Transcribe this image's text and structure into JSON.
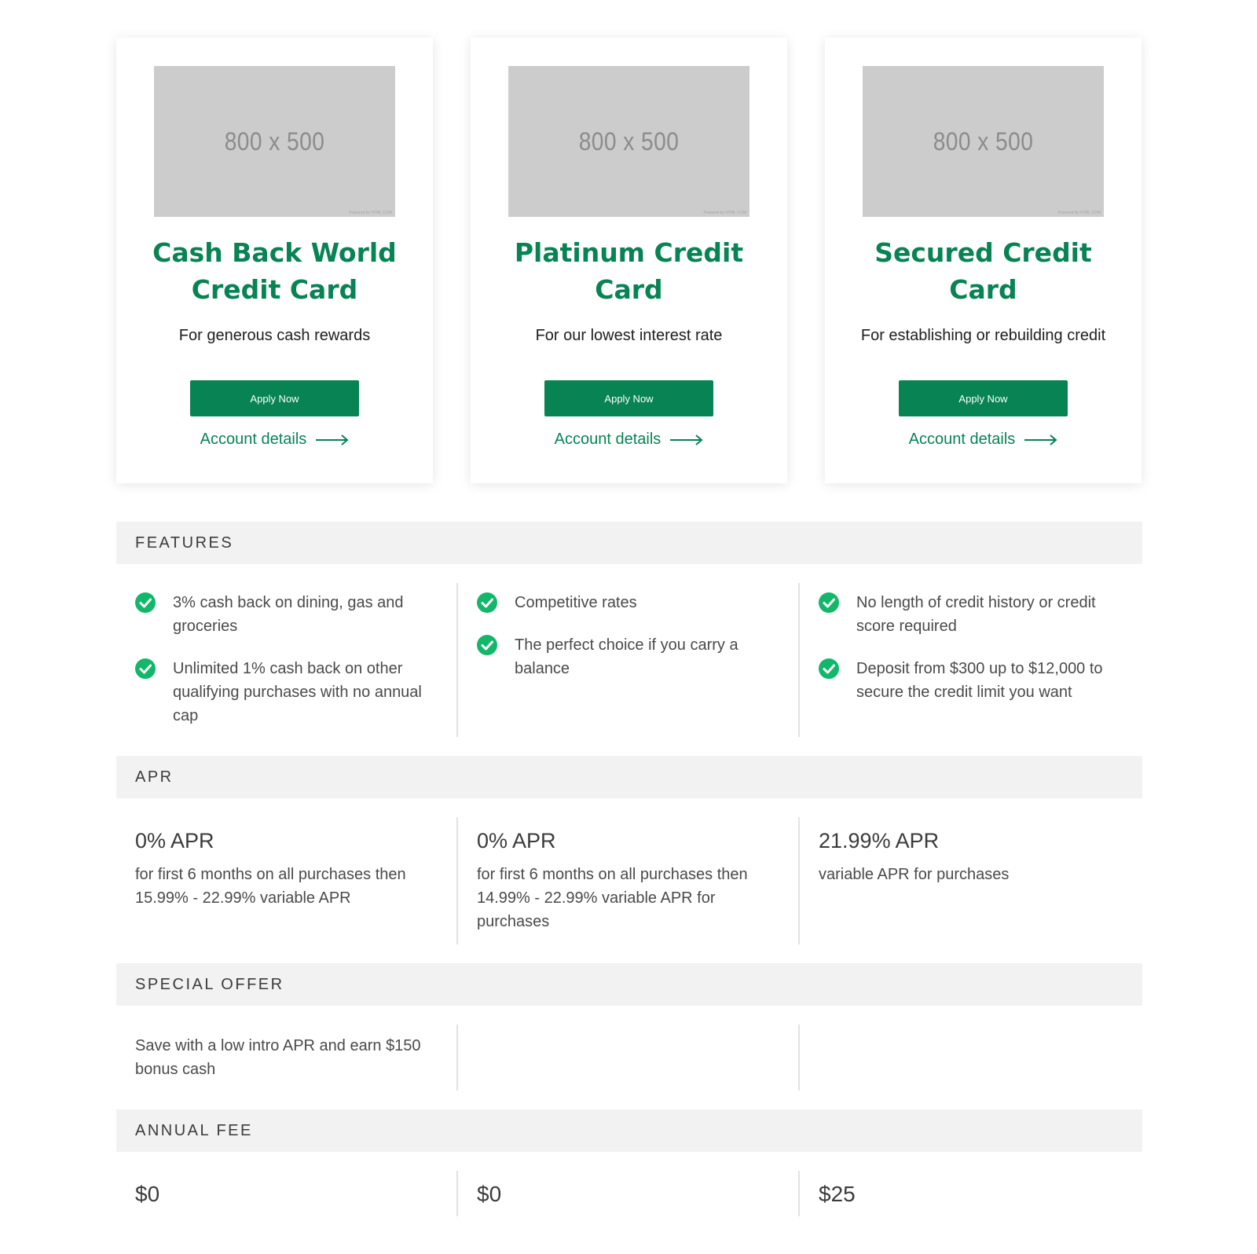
{
  "colors": {
    "brand": "#078354",
    "check": "#12b76a",
    "section_bg": "#f2f2f2"
  },
  "cards": [
    {
      "image_text": "800 x 500",
      "image_credit": "Powered by HTML.COM",
      "title": "Cash Back World Credit Card",
      "subtitle": "For generous cash rewards",
      "apply_label": "Apply Now",
      "details_label": "Account details"
    },
    {
      "image_text": "800 x 500",
      "image_credit": "Powered by HTML.COM",
      "title": "Platinum Credit Card",
      "subtitle": "For our lowest interest rate",
      "apply_label": "Apply Now",
      "details_label": "Account details"
    },
    {
      "image_text": "800 x 500",
      "image_credit": "Powered by HTML.COM",
      "title": "Secured Credit Card",
      "subtitle": "For establishing or rebuilding credit",
      "apply_label": "Apply Now",
      "details_label": "Account details"
    }
  ],
  "features": {
    "heading": "FEATURES",
    "columns": [
      [
        "3% cash back on dining, gas and groceries",
        "Unlimited 1% cash back on other qualifying purchases with no annual cap"
      ],
      [
        "Competitive rates",
        "The perfect choice if you carry a balance"
      ],
      [
        "No length of credit history or credit score required",
        "Deposit from $300 up to $12,000 to secure the credit limit you want"
      ]
    ]
  },
  "apr": {
    "heading": "APR",
    "columns": [
      {
        "rate": "0% APR",
        "desc": "for first 6 months on all purchases then 15.99% - 22.99% variable APR"
      },
      {
        "rate": "0% APR",
        "desc": "for first 6 months on all purchases then 14.99% - 22.99% variable APR for purchases"
      },
      {
        "rate": "21.99% APR",
        "desc": "variable APR for purchases"
      }
    ]
  },
  "special_offer": {
    "heading": "SPECIAL OFFER",
    "columns": [
      "Save with a low intro APR and earn $150 bonus cash",
      "",
      ""
    ]
  },
  "annual_fee": {
    "heading": "ANNUAL FEE",
    "columns": [
      "$0",
      "$0",
      "$25"
    ]
  }
}
